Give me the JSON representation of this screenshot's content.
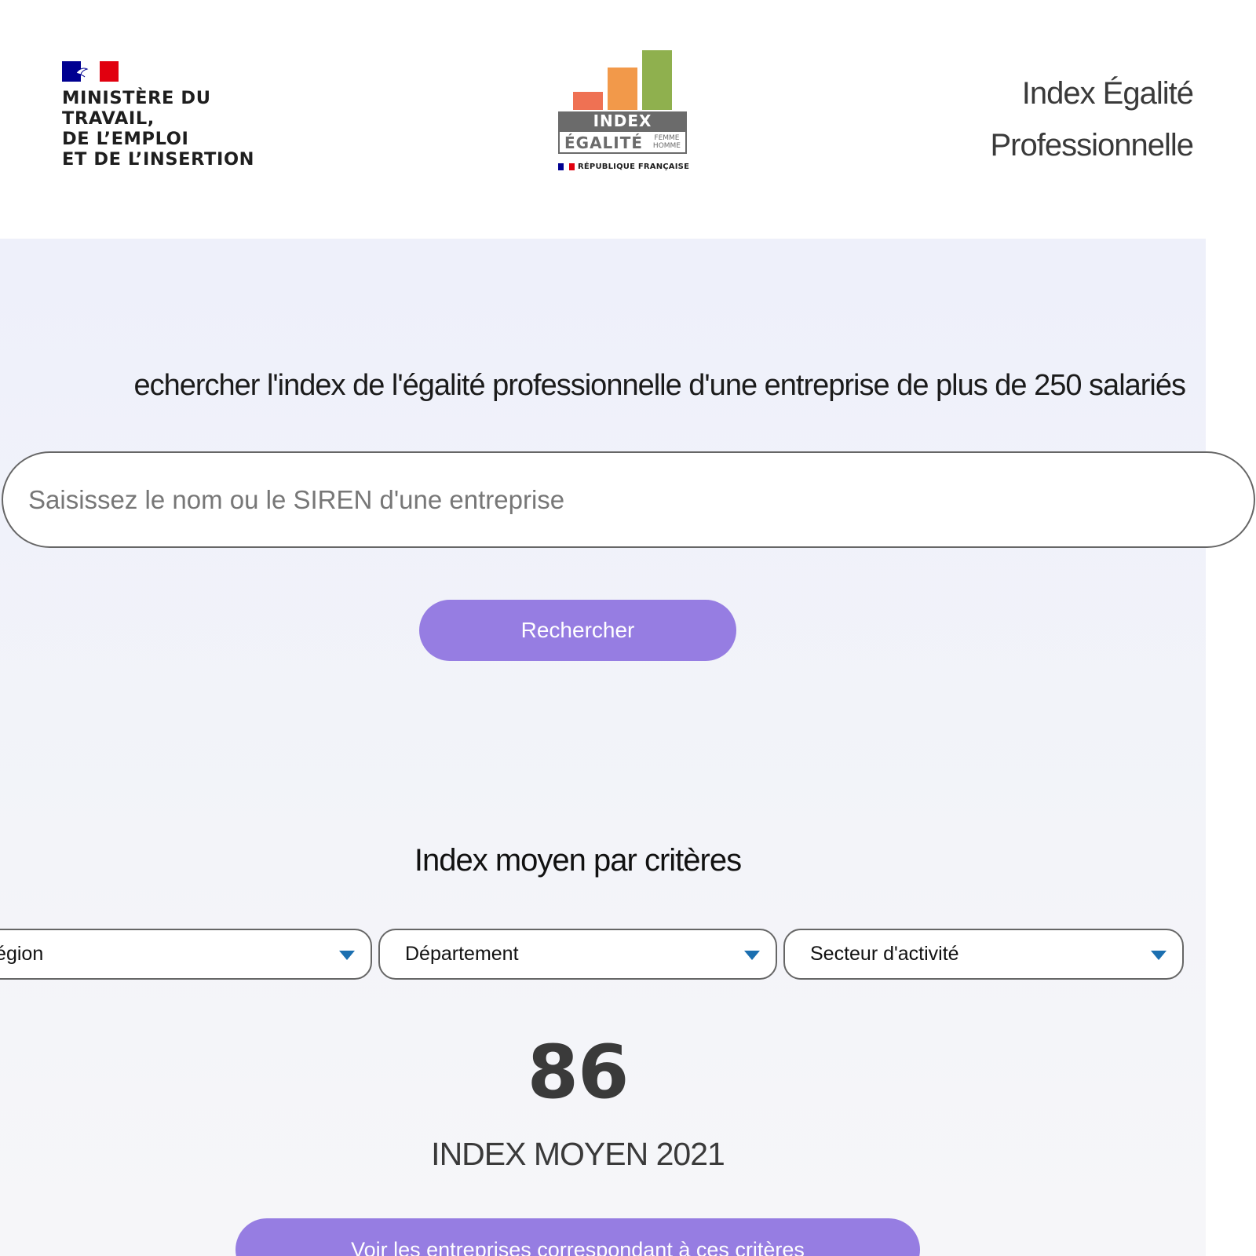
{
  "colors": {
    "accent": "#967de2",
    "main_bg": "#eef0fa",
    "caret": "#1b6fb0",
    "text_dark": "#3a3a3a",
    "flag_blue": "#000091",
    "flag_red": "#e1000f",
    "logo_bar_1": "#ef7153",
    "logo_bar_2": "#f2994a",
    "logo_bar_3": "#8fb04e"
  },
  "header": {
    "ministry_lines": [
      "MINISTÈRE DU",
      "TRAVAIL,",
      "DE L’EMPLOI",
      "ET DE L’INSERTION"
    ],
    "logo": {
      "index_word": "INDEX",
      "egalite_word": "ÉGALITÉ",
      "femme": "FEMME",
      "homme": "HOMME",
      "republique": "RÉPUBLIQUE FRANÇAISE"
    },
    "site_title_line1": "Index Égalité",
    "site_title_line2": "Professionnelle"
  },
  "search": {
    "title": "echercher l'index de l'égalité professionnelle d'une entreprise de plus de 250 salariés",
    "placeholder": "Saisissez le nom ou le SIREN d'une entreprise",
    "button_label": "Rechercher"
  },
  "criteria": {
    "title": "Index moyen par critères",
    "filters": [
      {
        "label": "Région"
      },
      {
        "label": "Département"
      },
      {
        "label": "Secteur d'activité"
      }
    ],
    "index_value": "86",
    "index_caption": "INDEX MOYEN 2021",
    "see_button_label": "Voir les entreprises correspondant à ces critères"
  }
}
